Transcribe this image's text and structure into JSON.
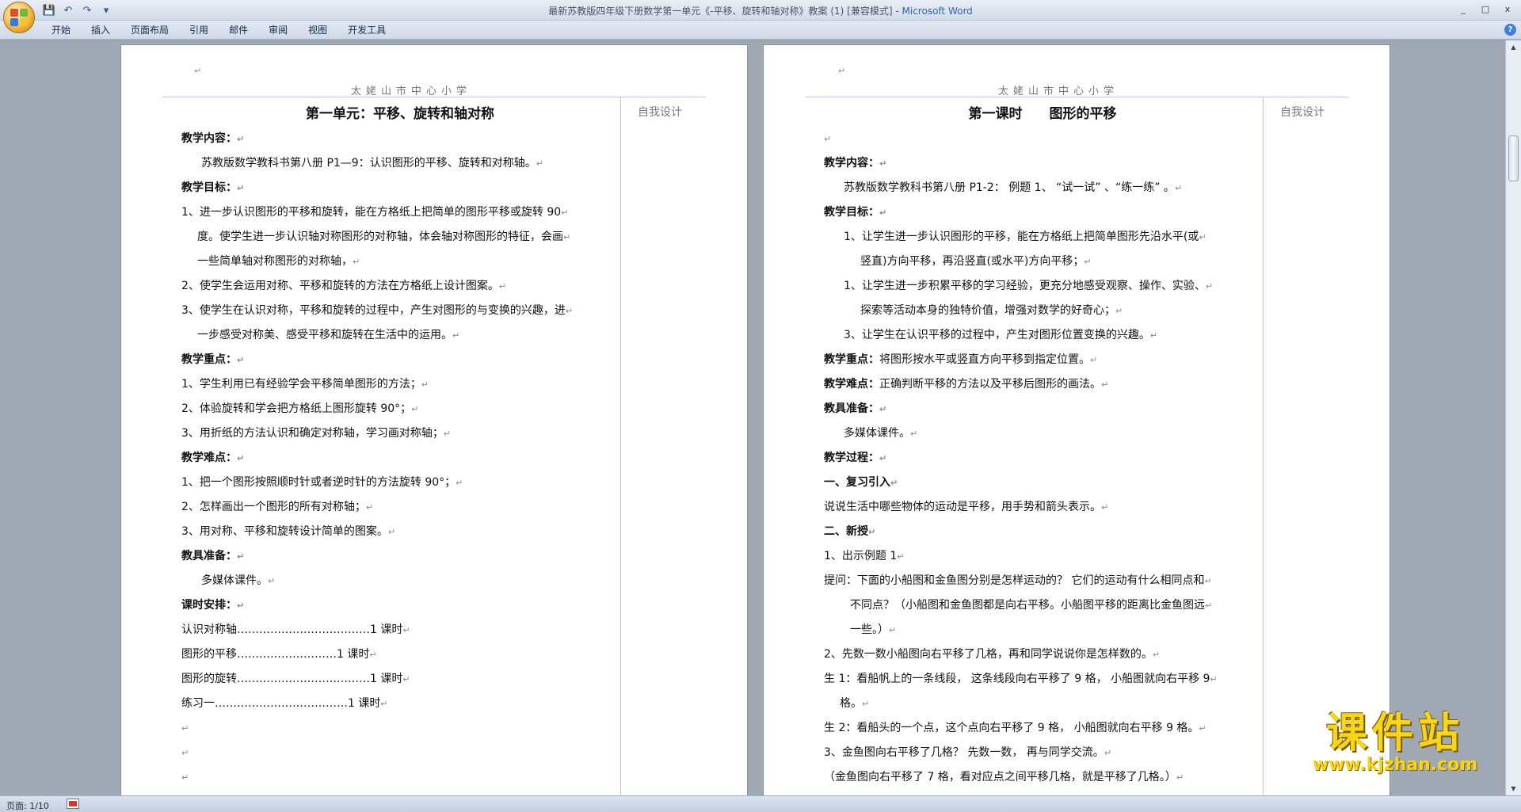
{
  "window": {
    "title": "最新苏教版四年级下册数学第一单元《-平移、旋转和轴对称》教案 (1) [兼容模式]",
    "app_name": "Microsoft Word",
    "controls": [
      "_",
      "□",
      "x"
    ]
  },
  "quick_access": {
    "save": "💾",
    "undo": "↶",
    "redo": "↷",
    "customize": "▾"
  },
  "ribbon": {
    "tabs": [
      "开始",
      "插入",
      "页面布局",
      "引用",
      "邮件",
      "审阅",
      "视图",
      "开发工具"
    ],
    "help": "?"
  },
  "pages": [
    {
      "school": "太姥山市中心小学",
      "side_label": "自我设计",
      "title": "第一单元：平移、旋转和轴对称",
      "lines": [
        {
          "t": "教学内容：",
          "s": "b"
        },
        {
          "t": "苏教版数学教科书第八册 P1—9：认识图形的平移、旋转和对称轴。",
          "s": "ind"
        },
        {
          "t": "教学目标：",
          "s": "b"
        },
        {
          "t": "1、进一步认识图形的平移和旋转，能在方格纸上把简单的图形平移或旋转 90",
          "s": ""
        },
        {
          "t": "度。使学生进一步认识轴对称图形的对称轴，体会轴对称图形的特征，会画",
          "s": "hang"
        },
        {
          "t": "一些简单轴对称图形的对称轴，",
          "s": "hang"
        },
        {
          "t": "2、使学生会运用对称、平移和旋转的方法在方格纸上设计图案。",
          "s": ""
        },
        {
          "t": "3、使学生在认识对称，平移和旋转的过程中，产生对图形的与变换的兴趣，进",
          "s": ""
        },
        {
          "t": "一步感受对称美、感受平移和旋转在生活中的运用。",
          "s": "hang"
        },
        {
          "t": "教学重点：",
          "s": "b"
        },
        {
          "t": "1、学生利用已有经验学会平移简单图形的方法；",
          "s": ""
        },
        {
          "t": "2、体验旋转和学会把方格纸上图形旋转 90°；",
          "s": ""
        },
        {
          "t": "3、用折纸的方法认识和确定对称轴，学习画对称轴；",
          "s": ""
        },
        {
          "t": "教学难点：",
          "s": "b"
        },
        {
          "t": "1、把一个图形按照顺时针或者逆时针的方法旋转 90°；",
          "s": ""
        },
        {
          "t": "2、怎样画出一个图形的所有对称轴；",
          "s": ""
        },
        {
          "t": "3、用对称、平移和旋转设计简单的图案。",
          "s": ""
        },
        {
          "t": "教具准备：",
          "s": "b"
        },
        {
          "t": "多媒体课件。",
          "s": "ind"
        },
        {
          "t": "课时安排：",
          "s": "b"
        },
        {
          "t": "认识对称轴………………………………1 课时",
          "s": ""
        },
        {
          "t": "图形的平移………………………1 课时",
          "s": ""
        },
        {
          "t": "图形的旋转………………………………1 课时",
          "s": ""
        },
        {
          "t": "练习一………………………………1 课时",
          "s": ""
        },
        {
          "t": "",
          "s": ""
        },
        {
          "t": "",
          "s": ""
        },
        {
          "t": "",
          "s": ""
        }
      ]
    },
    {
      "school": "太姥山市中心小学",
      "side_label": "自我设计",
      "title": "第一课时　　图形的平移",
      "lines": [
        {
          "t": "",
          "s": ""
        },
        {
          "t": "教学内容：",
          "s": "b"
        },
        {
          "t": "苏教版数学教科书第八册 P1-2：  例题 1、 “试一试” 、“练一练” 。",
          "s": "ind"
        },
        {
          "t": "教学目标：",
          "s": "b"
        },
        {
          "t": "1、让学生进一步认识图形的平移，能在方格纸上把简单图形先沿水平(或",
          "s": "ind"
        },
        {
          "t": "竖直)方向平移，再沿竖直(或水平)方向平移；",
          "s": "ind2"
        },
        {
          "t": "1、让学生进一步积累平移的学习经验，更充分地感受观察、操作、实验、",
          "s": "ind"
        },
        {
          "t": "探索等活动本身的独特价值，增强对数学的好奇心；",
          "s": "ind2"
        },
        {
          "t": "3、让学生在认识平移的过程中，产生对图形位置变换的兴趣。",
          "s": "ind"
        },
        {
          "t": "教学重点：将图形按水平或竖直方向平移到指定位置。",
          "s": "bl"
        },
        {
          "t": "教学难点：正确判断平移的方法以及平移后图形的画法。",
          "s": "bl"
        },
        {
          "t": "教具准备：",
          "s": "b"
        },
        {
          "t": "多媒体课件。",
          "s": "ind"
        },
        {
          "t": "教学过程：",
          "s": "b"
        },
        {
          "t": "一、复习引入",
          "s": "b"
        },
        {
          "t": "说说生活中哪些物体的运动是平移，用手势和箭头表示。",
          "s": ""
        },
        {
          "t": "二、新授",
          "s": "b"
        },
        {
          "t": "1、出示例题 1",
          "s": ""
        },
        {
          "t": "提问：下面的小船图和金鱼图分别是怎样运动的？  它们的运动有什么相同点和",
          "s": ""
        },
        {
          "t": "不同点？（小船图和金鱼图都是向右平移。小船图平移的距离比金鱼图远",
          "s": "ind3"
        },
        {
          "t": "一些。）",
          "s": "ind3"
        },
        {
          "t": "2、先数一数小船图向右平移了几格，再和同学说说你是怎样数的。",
          "s": ""
        },
        {
          "t": "生 1：看船帆上的一条线段，  这条线段向右平移了 9 格，  小船图就向右平移 9",
          "s": ""
        },
        {
          "t": "格。",
          "s": "hang"
        },
        {
          "t": "生 2：看船头的一个点，这个点向右平移了 9 格，  小船图就向右平移 9 格。",
          "s": ""
        },
        {
          "t": "3、金鱼图向右平移了几格？  先数一数，  再与同学交流。",
          "s": ""
        },
        {
          "t": "（金鱼图向右平移了 7 格，看对应点之间平移几格，就是平移了几格。）",
          "s": ""
        }
      ]
    }
  ],
  "status": {
    "page_info": "页面: 1/10"
  },
  "watermark": {
    "text": "课件站",
    "url": "www.kjzhan.com"
  }
}
